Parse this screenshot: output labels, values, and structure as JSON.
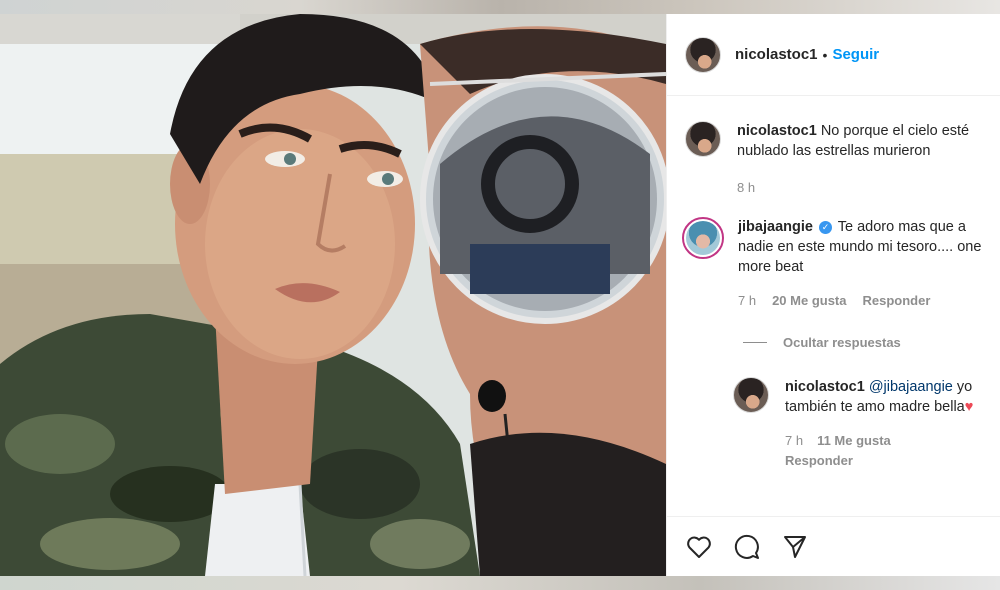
{
  "post": {
    "author": "nicolastoc1",
    "separator": "•",
    "follow_label": "Seguir"
  },
  "caption": {
    "username": "nicolastoc1",
    "text": "No porque el cielo esté nublado las estrellas murieron",
    "time": "8 h"
  },
  "comment": {
    "username": "jibajaangie",
    "verified_icon": "verified-badge-icon",
    "text": "Te adoro mas que a nadie en este mundo mi tesoro.... one more beat",
    "time": "7 h",
    "likes": "20 Me gusta",
    "reply_label": "Responder",
    "hide_replies_label": "Ocultar respuestas"
  },
  "reply": {
    "username": "nicolastoc1",
    "mention": "@jibajaangie",
    "text": "yo también te amo madre bella",
    "emoji": "♥",
    "time": "7 h",
    "likes": "11 Me gusta",
    "reply_label": "Responder"
  },
  "actions": {
    "like_icon": "heart-icon",
    "comment_icon": "comment-icon",
    "share_icon": "share-icon"
  },
  "colors": {
    "accent": "#0095f6",
    "verified": "#3897f0",
    "heart": "#ed4956"
  }
}
